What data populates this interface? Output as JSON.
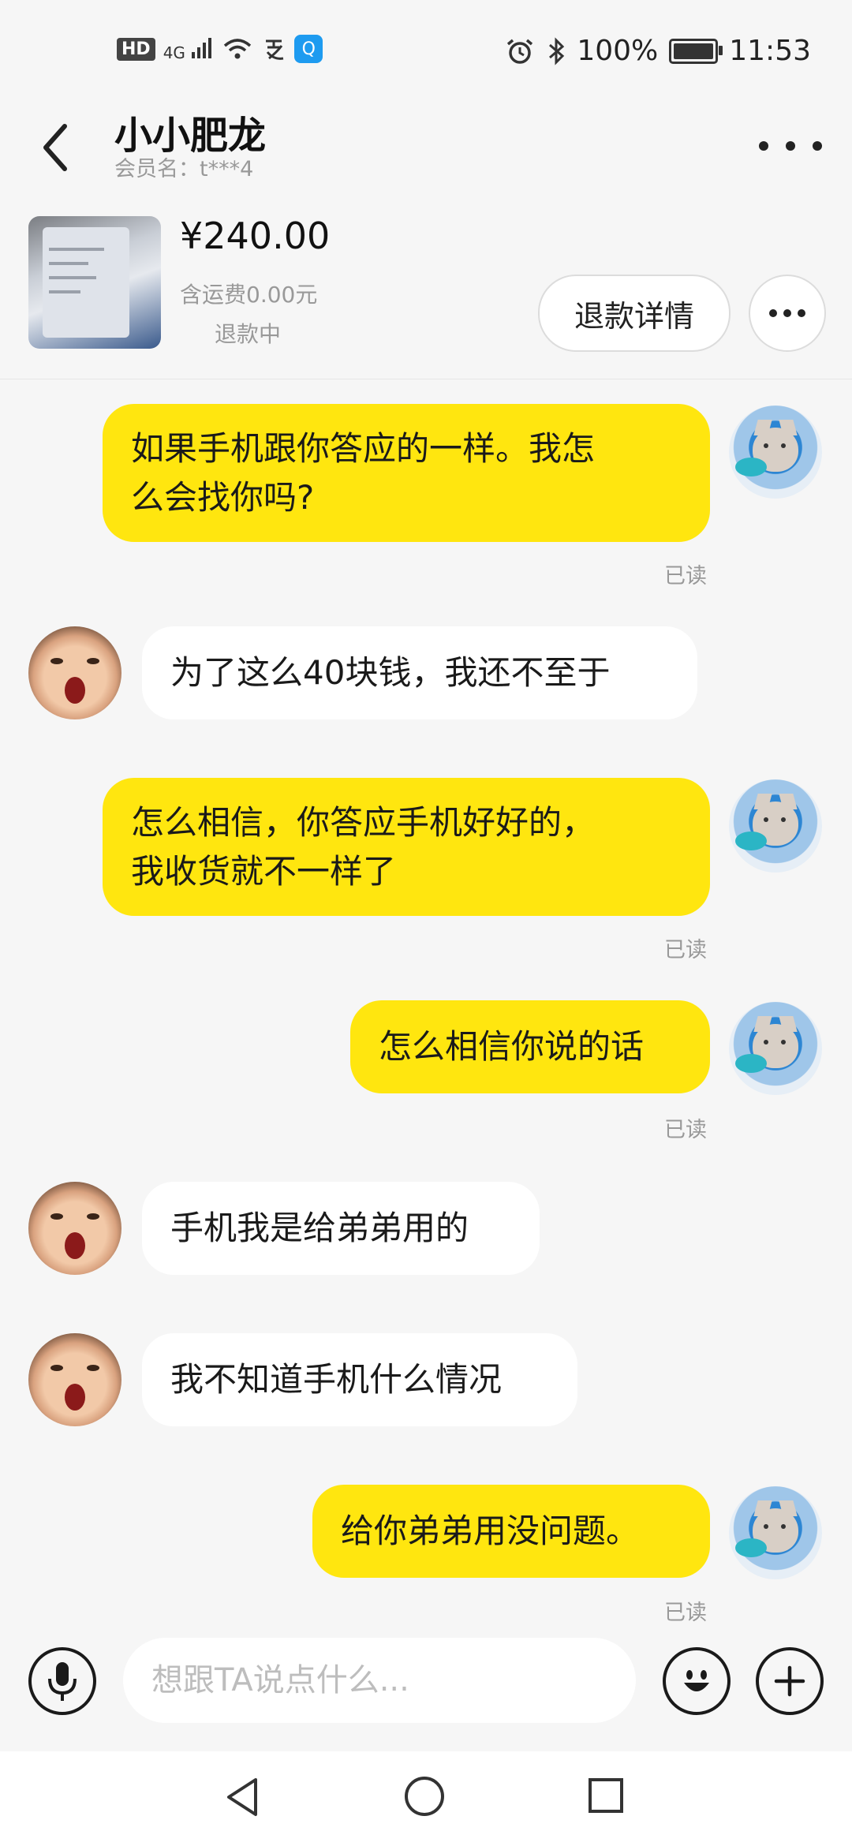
{
  "status_bar": {
    "left_icons": [
      "hd-icon",
      "4g-signal-icon",
      "wifi-icon",
      "alipay-icon",
      "app-badge-icon"
    ],
    "hd": "HD",
    "net": "4G",
    "battery": "100%",
    "time": "11:53"
  },
  "header": {
    "title": "小小肥龙",
    "subtitle": "会员名：t***4"
  },
  "order": {
    "price": "¥240.00",
    "shipping": "含运费0.00元",
    "status": "退款中",
    "refund_button": "退款详情"
  },
  "messages": [
    {
      "side": "me",
      "lines": [
        "如果手机跟你答应的一样。我怎",
        "么会找你吗?"
      ],
      "status": "已读"
    },
    {
      "side": "them",
      "lines": [
        "为了这么40块钱，我还不至于"
      ]
    },
    {
      "side": "me",
      "lines": [
        "怎么相信，你答应手机好好的，",
        "我收货就不一样了"
      ],
      "status": "已读"
    },
    {
      "side": "me",
      "lines": [
        "怎么相信你说的话"
      ],
      "status": "已读"
    },
    {
      "side": "them",
      "lines": [
        "手机我是给弟弟用的"
      ]
    },
    {
      "side": "them",
      "lines": [
        "我不知道手机什么情况"
      ]
    },
    {
      "side": "me",
      "lines": [
        "给你弟弟用没问题。"
      ],
      "status": "已读"
    }
  ],
  "input": {
    "value": "",
    "placeholder": "想跟TA说点什么..."
  },
  "colors": {
    "my_bubble": "#ffe60f",
    "their_bubble": "#ffffff",
    "background": "#f6f6f6"
  }
}
